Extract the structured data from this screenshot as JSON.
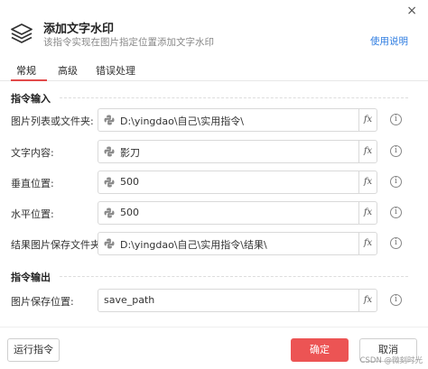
{
  "header": {
    "title": "添加文字水印",
    "subtitle": "该指令实现在图片指定位置添加文字水印",
    "help_label": "使用说明",
    "close_glyph": "×"
  },
  "tabs": [
    {
      "label": "常规",
      "active": true
    },
    {
      "label": "高级",
      "active": false
    },
    {
      "label": "错误处理",
      "active": false
    }
  ],
  "inputs_section": {
    "title": "指令输入",
    "fields": [
      {
        "label": "图片列表或文件夹:",
        "value": "D:\\yingdao\\自己\\实用指令\\"
      },
      {
        "label": "文字内容:",
        "value": "影刀"
      },
      {
        "label": "垂直位置:",
        "value": "500"
      },
      {
        "label": "水平位置:",
        "value": "500"
      },
      {
        "label": "结果图片保存文件夹:",
        "value": "D:\\yingdao\\自己\\实用指令\\结果\\"
      }
    ]
  },
  "outputs_section": {
    "title": "指令输出",
    "fields": [
      {
        "label": "图片保存位置:",
        "value": "save_path"
      }
    ]
  },
  "fx_label": "fx",
  "info_glyph": "i",
  "footer": {
    "run_label": "运行指令",
    "ok_label": "确定",
    "cancel_label": "取消"
  },
  "watermark": "CSDN @微刻时光",
  "colors": {
    "accent": "#ec5454",
    "link": "#2f7de1"
  }
}
